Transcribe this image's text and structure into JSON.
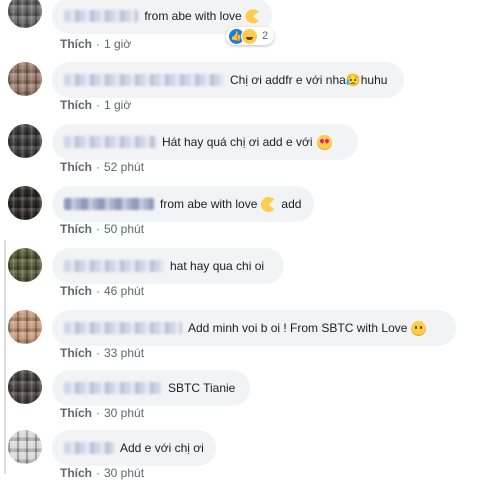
{
  "comments": [
    {
      "text": "from abe with love",
      "emoji": "pacman-emoji",
      "meta": {
        "like": "Thích",
        "time": "1 giờ"
      },
      "reactions": {
        "count": "2",
        "types": [
          "like",
          "haha"
        ]
      }
    },
    {
      "text": "Chị ơi addfr e với nha😥huhu",
      "emoji": "",
      "meta": {
        "like": "Thích",
        "time": "1 giờ"
      }
    },
    {
      "text": "Hát hay quá chị ơi add e với",
      "emoji": "heart-eyes-emoji",
      "meta": {
        "like": "Thích",
        "time": "52 phút"
      }
    },
    {
      "text": "from abe with love",
      "text2": "add",
      "emoji": "pacman-emoji",
      "meta": {
        "like": "Thích",
        "time": "50 phút"
      }
    },
    {
      "text": "hat hay qua chi oi",
      "emoji": "",
      "meta": {
        "like": "Thích",
        "time": "46 phút"
      }
    },
    {
      "text": "Add minh voi b oi ! From SBTC with Love",
      "emoji": "smiling-emoji",
      "meta": {
        "like": "Thích",
        "time": "33 phút"
      }
    },
    {
      "text": "SBTC Tianie",
      "emoji": "",
      "meta": {
        "like": "Thích",
        "time": "30 phút"
      }
    },
    {
      "text": "Add e với chị ơi",
      "emoji": "",
      "meta": {
        "like": "Thích",
        "time": "30 phút"
      }
    }
  ]
}
